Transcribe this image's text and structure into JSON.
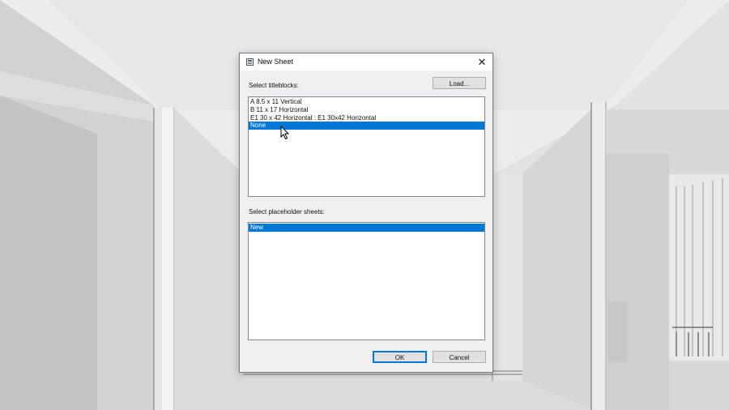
{
  "dialog": {
    "title": "New Sheet",
    "close_glyph": "✕",
    "titleblocks_label": "Select titleblocks:",
    "load_button": "Load...",
    "titleblocks": [
      {
        "label": "A 8.5 x 11 Vertical",
        "selected": false
      },
      {
        "label": "B 11 x 17 Horizontal",
        "selected": false
      },
      {
        "label": "E1 30 x 42 Horizontal : E1 30x42 Horizontal",
        "selected": false
      },
      {
        "label": "None",
        "selected": true
      }
    ],
    "placeholder_label": "Select placeholder sheets:",
    "placeholder_sheets": [
      {
        "label": "New",
        "selected": true
      }
    ],
    "ok_button": "OK",
    "cancel_button": "Cancel"
  },
  "colors": {
    "selection": "#0078d7",
    "dialog_bg": "#f0f0f0"
  },
  "icons": {
    "app": "revit-app-icon",
    "close": "close-icon",
    "cursor": "mouse-pointer-icon"
  }
}
